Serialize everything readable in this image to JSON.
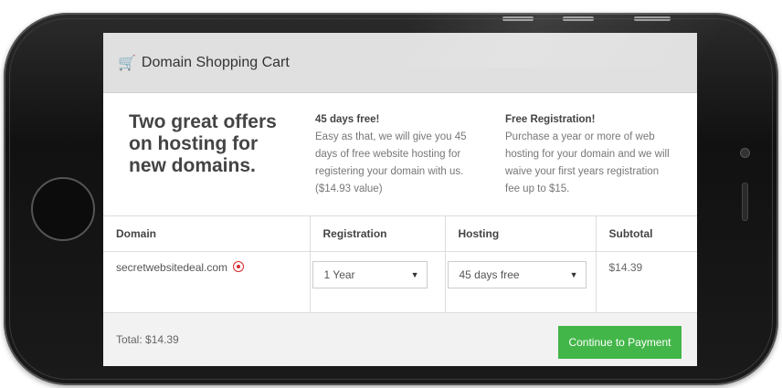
{
  "header": {
    "title": "Domain Shopping Cart",
    "icon": "cart-icon"
  },
  "offers": {
    "headline": "Two great offers on hosting for new domains.",
    "offer1": {
      "title": "45 days free!",
      "body": "Easy as that, we will give you 45 days of free website hosting for registering your domain with us. ($14.93 value)"
    },
    "offer2": {
      "title": "Free Registration!",
      "body": "Purchase a year or more of web hosting for your domain and we will waive your first years registration fee up to $15."
    }
  },
  "table": {
    "columns": [
      "Domain",
      "Registration",
      "Hosting",
      "Subtotal"
    ],
    "row": {
      "domain": "secretwebsitedeal.com",
      "registration": "1 Year",
      "hosting": "45 days free",
      "subtotal": "$14.39"
    }
  },
  "footer": {
    "total": "Total: $14.39",
    "pay_label": "Continue to Payment"
  },
  "colors": {
    "accent": "#43b649",
    "remove": "#d9292d",
    "header_bg": "#e0e0e0"
  }
}
